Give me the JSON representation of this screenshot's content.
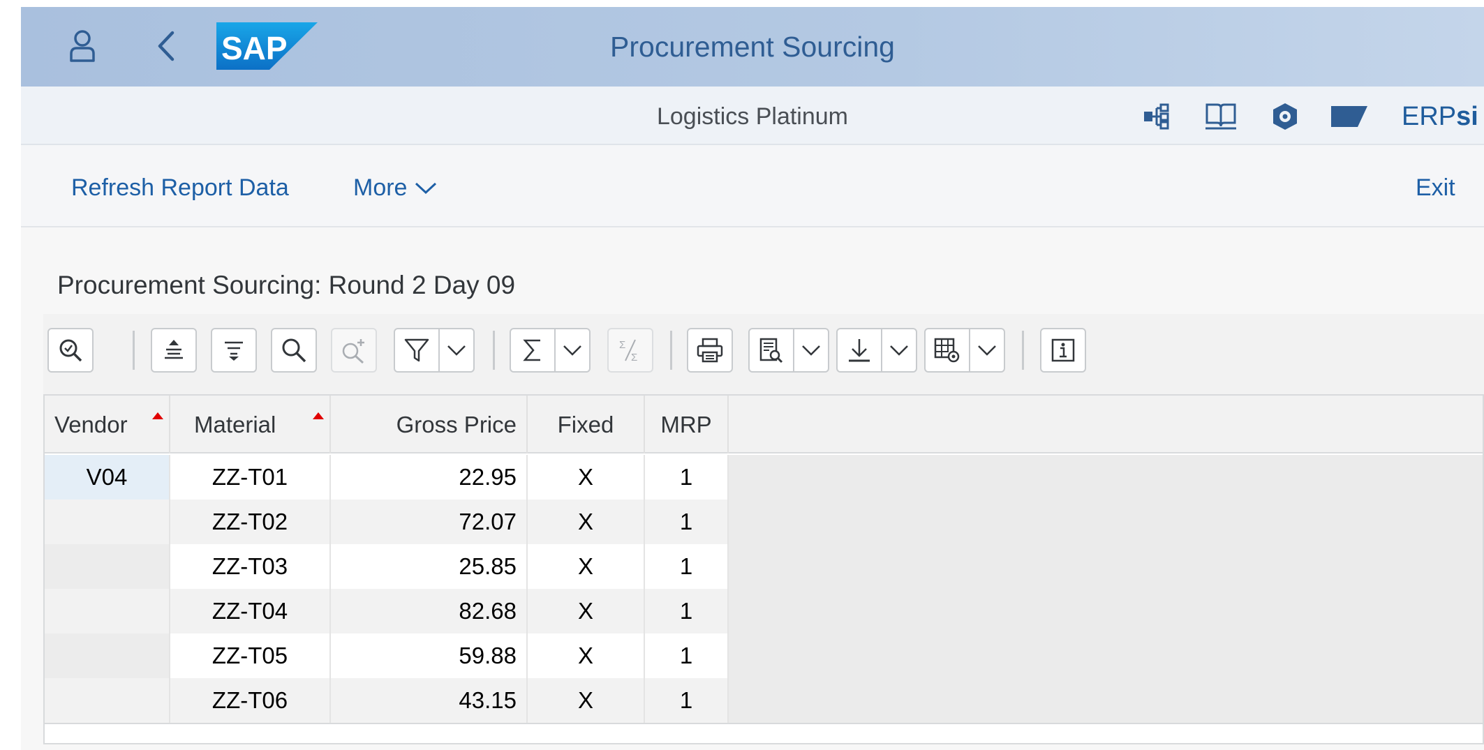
{
  "shell": {
    "title": "Procurement Sourcing",
    "logo_text": "SAP"
  },
  "subheader": {
    "system_name": "Logistics Platinum",
    "brand_prefix": "ERP",
    "brand_suffix": "si"
  },
  "toolbar": {
    "refresh_label": "Refresh Report Data",
    "more_label": "More",
    "exit_label": "Exit"
  },
  "page": {
    "title": "Procurement Sourcing: Round 2 Day 09"
  },
  "table": {
    "headers": {
      "vendor": "Vendor",
      "material": "Material",
      "gross_price": "Gross Price",
      "fixed": "Fixed",
      "mrp": "MRP"
    },
    "rows": [
      {
        "vendor": "V04",
        "material": "ZZ-T01",
        "gross_price": "22.95",
        "fixed": "X",
        "mrp": "1"
      },
      {
        "vendor": "",
        "material": "ZZ-T02",
        "gross_price": "72.07",
        "fixed": "X",
        "mrp": "1"
      },
      {
        "vendor": "",
        "material": "ZZ-T03",
        "gross_price": "25.85",
        "fixed": "X",
        "mrp": "1"
      },
      {
        "vendor": "",
        "material": "ZZ-T04",
        "gross_price": "82.68",
        "fixed": "X",
        "mrp": "1"
      },
      {
        "vendor": "",
        "material": "ZZ-T05",
        "gross_price": "59.88",
        "fixed": "X",
        "mrp": "1"
      },
      {
        "vendor": "",
        "material": "ZZ-T06",
        "gross_price": "43.15",
        "fixed": "X",
        "mrp": "1"
      }
    ]
  },
  "colors": {
    "shell_bg": "#b4c9e3",
    "title_blue": "#2f5d93",
    "link_blue": "#1d5fa6",
    "sort_indicator": "#e00000"
  }
}
